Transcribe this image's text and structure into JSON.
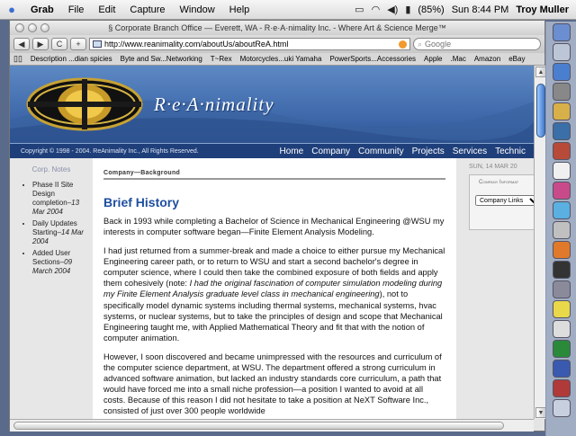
{
  "menubar": {
    "app": "Grab",
    "items": [
      "File",
      "Edit",
      "Capture",
      "Window",
      "Help"
    ],
    "battery": "(85%)",
    "clock": "Sun 8:44 PM",
    "user": "Troy Muller"
  },
  "window": {
    "title": "§ Corporate Branch Office — Everett, WA - R·e·A·nimality Inc. - Where Art & Science Merge™"
  },
  "toolbar": {
    "back": "◀",
    "forward": "▶",
    "reload": "C",
    "add": "+",
    "url": "http://www.reanimality.com/aboutUs/aboutReA.html",
    "search_placeholder": "Google"
  },
  "bookmarks": [
    "Description ...dian spicies",
    "Byte and Sw...Networking",
    "T~Rex",
    "Motorcycles...uki Yamaha",
    "PowerSports...Accessories",
    "Apple",
    ".Mac",
    "Amazon",
    "eBay"
  ],
  "page": {
    "brand": "R·e·A·nimality",
    "copyright": "Copyright © 1998 - 2004. ReAnimality Inc., All Rights Reserved.",
    "nav": [
      "Home",
      "Company",
      "Community",
      "Projects",
      "Services",
      "Technic"
    ],
    "corp_notes_title": "Corp. Notes",
    "corp_notes": [
      {
        "text": "Phase II Site Design completion–",
        "date": "13 Mar 2004"
      },
      {
        "text": "Daily Updates Starting–",
        "date": "14 Mar 2004"
      },
      {
        "text": "Added User Sections–",
        "date": "09 March 2004"
      }
    ],
    "breadcrumb": "Company—Background",
    "heading": "Brief History",
    "para1": "Back in 1993 while completing a Bachelor of Science in Mechanical Engineering @WSU my interests in computer software began—Finite Element Analysis Modeling.",
    "para2a": "I had just returned from a summer-break and made a choice to either pursue my Mechanical Engineering career path, or to return to WSU and start a second bachelor's degree in computer science, where I could then take the combined exposure of both fields and apply them cohesively (note: ",
    "para2b": "I had the original fascination of computer simulation modeling during my Finite Element Analysis graduate level class in mechanical engineering",
    "para2c": "), not to specifically model dynamic systems including thermal systems, mechanical systems, hvac systems, or nuclear systems, but to take the principles of design and scope that Mechanical Engineering taught me, with Applied Mathematical Theory and fit that with the notion of computer animation.",
    "para3": "However, I soon discovered and became unimpressed with the resources and curriculum of the computer science department, at WSU. The department offered a strong curriculum in advanced software animation, but lacked an industry standards core curriculum, a path that would have forced me into a small niche profession—a position I wanted to avoid at all costs. Because of this reason I did not hesitate to take a position at NeXT Software Inc., consisted of just over 300 people worldwide",
    "date": "SUN, 14 MAR 20",
    "company_info_title": "Company Informat",
    "company_links": "Company Links"
  }
}
